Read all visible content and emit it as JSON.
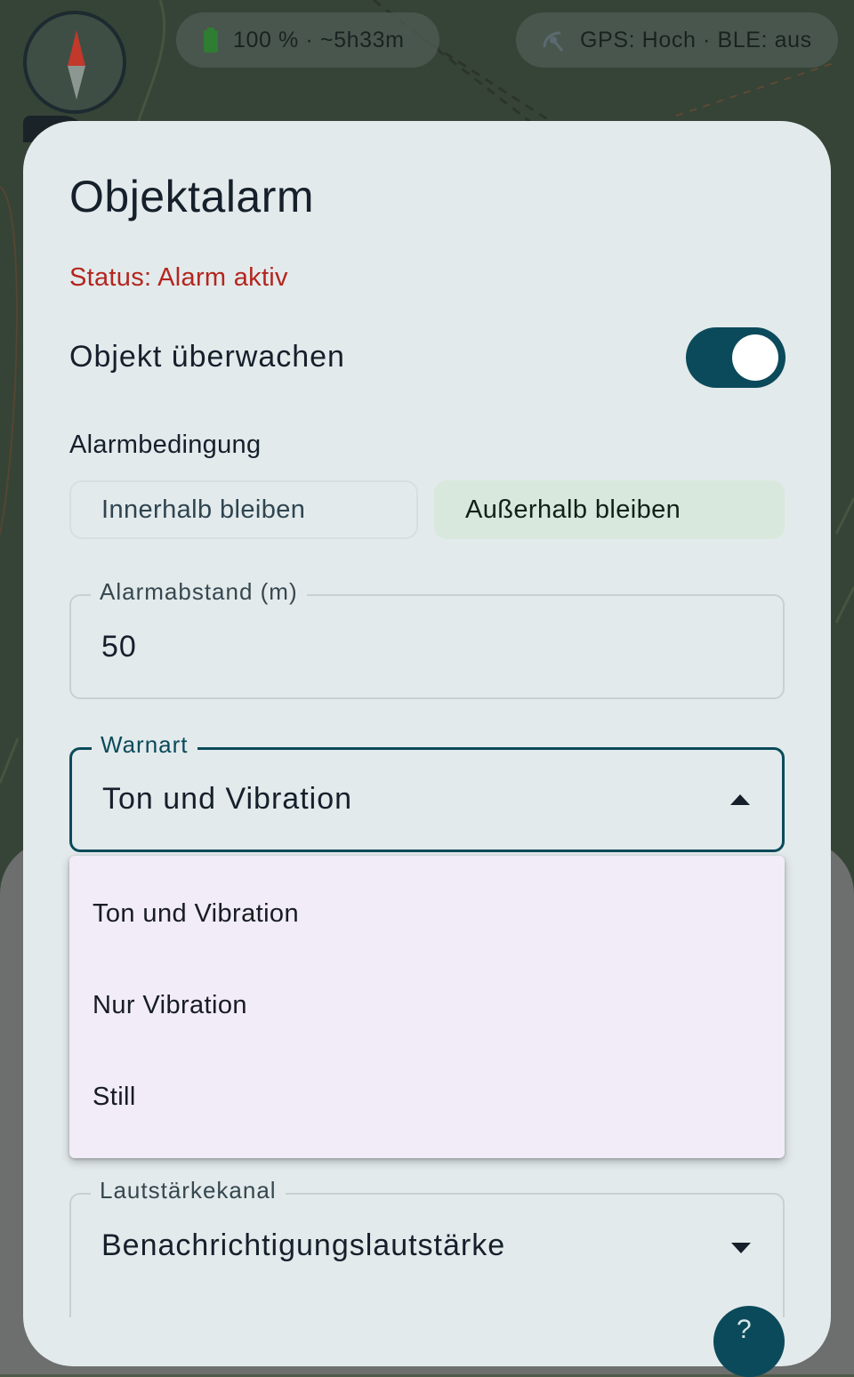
{
  "status_bar": {
    "battery_text": "100 % · ~5h33m",
    "gps_text": "GPS: Hoch · BLE: aus",
    "battery_icon": "battery-icon",
    "gps_icon": "satellite-icon"
  },
  "compass": {
    "icon": "compass-icon"
  },
  "dialog": {
    "title": "Objektalarm",
    "status": "Status: Alarm aktiv",
    "monitor_label": "Objekt überwachen",
    "monitor_enabled": true,
    "condition_label": "Alarmbedingung",
    "condition_options": [
      "Innerhalb bleiben",
      "Außerhalb bleiben"
    ],
    "condition_selected": "Außerhalb bleiben",
    "distance": {
      "label": "Alarmabstand (m)",
      "value": "50"
    },
    "warn_type": {
      "label": "Warnart",
      "value": "Ton und Vibration",
      "options": [
        "Ton und Vibration",
        "Nur Vibration",
        "Still"
      ]
    },
    "volume_channel": {
      "label": "Lautstärkekanal",
      "value": "Benachrichtigungslautstärke"
    }
  },
  "colors": {
    "accent": "#0b4a5a",
    "status_red": "#b3261e",
    "dialog_bg": "#e3eaec",
    "menu_bg": "#f1ecf7",
    "selected_segment_bg": "#d8e8dd"
  }
}
